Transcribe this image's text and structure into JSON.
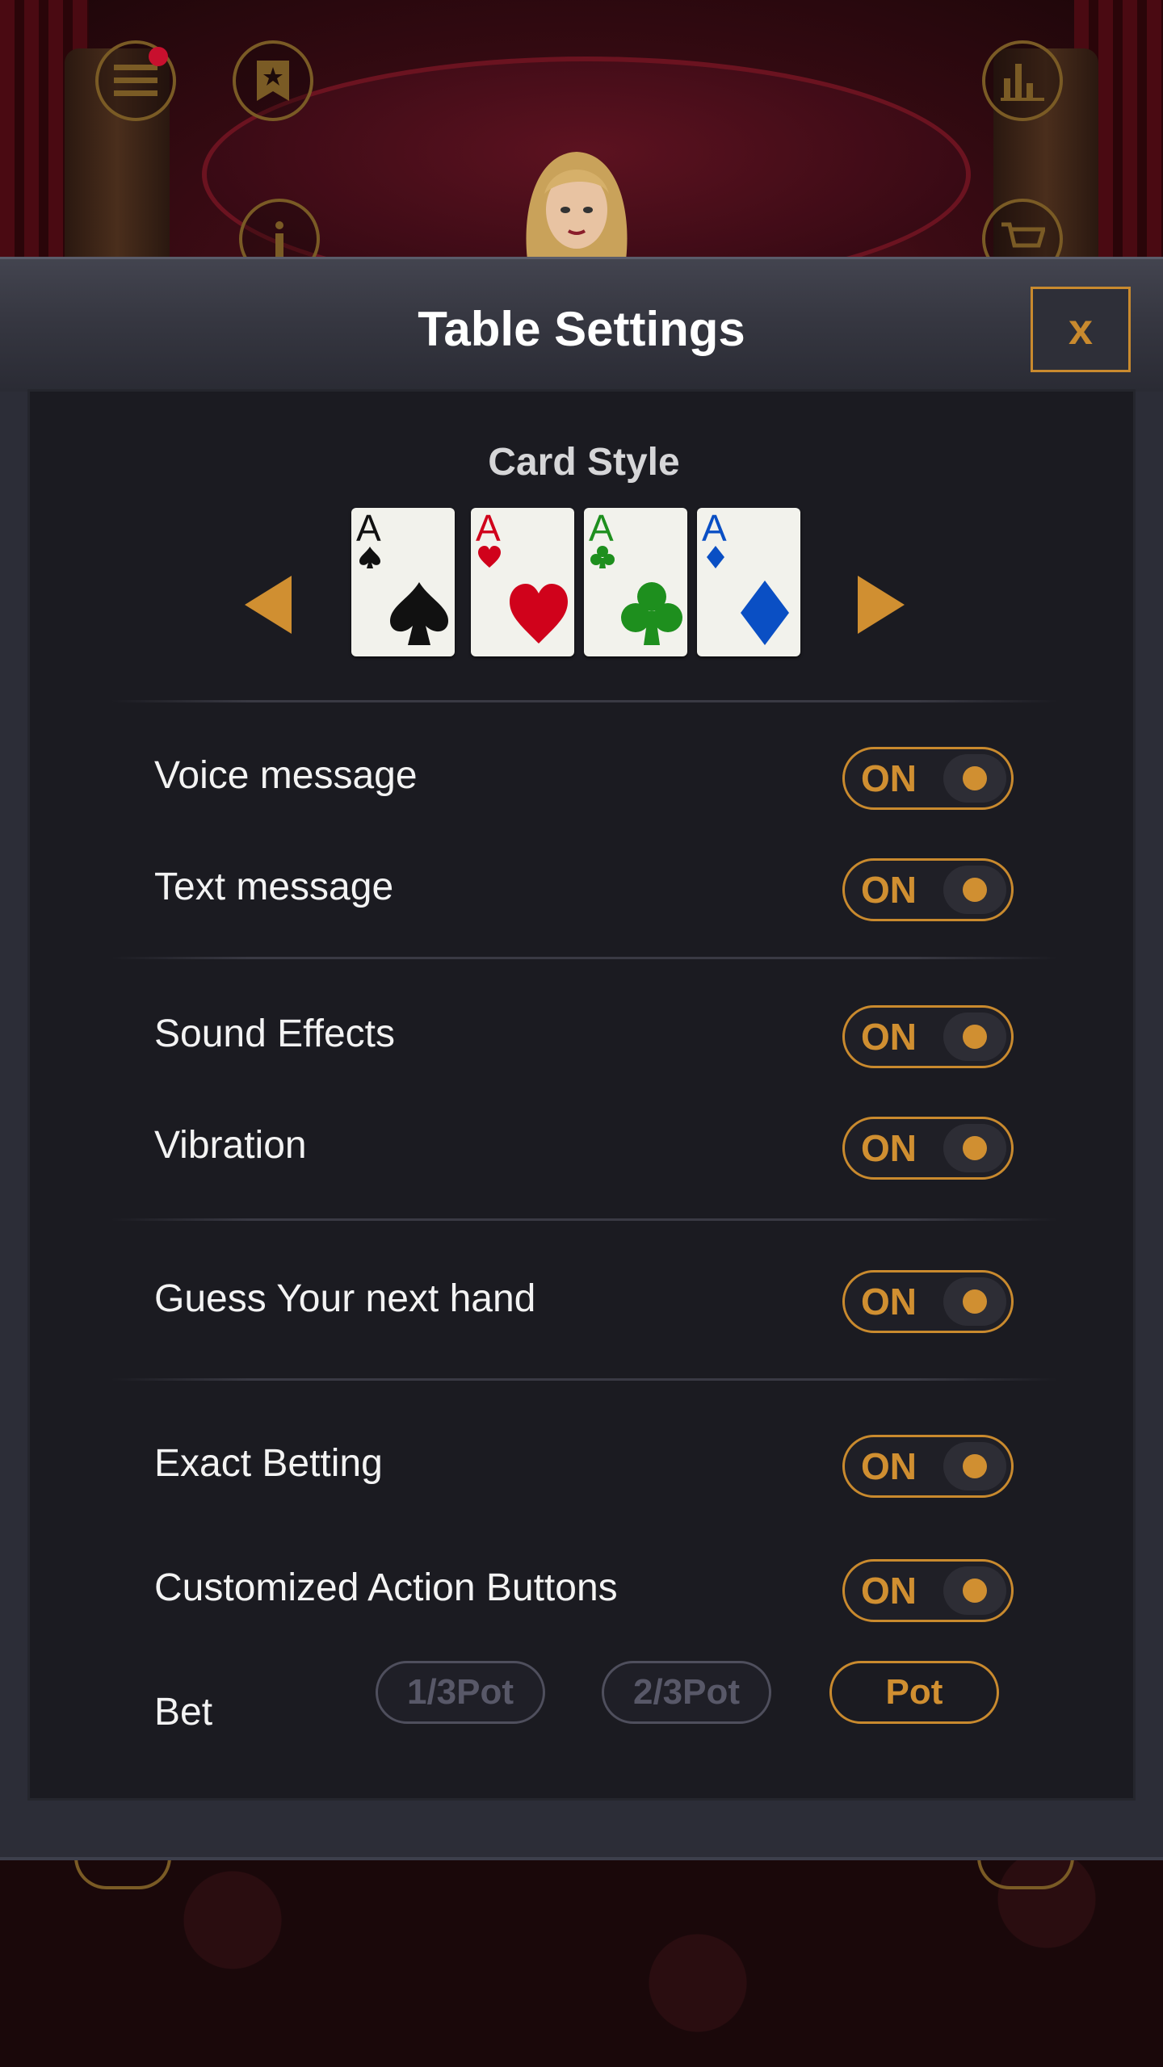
{
  "modal": {
    "title": "Table Settings",
    "close_label": "x"
  },
  "card_style": {
    "title": "Card Style",
    "cards": [
      {
        "rank": "A",
        "suit": "spades",
        "color": "#111111"
      },
      {
        "rank": "A",
        "suit": "hearts",
        "color": "#d0021b"
      },
      {
        "rank": "A",
        "suit": "clubs",
        "color": "#1e8f1e"
      },
      {
        "rank": "A",
        "suit": "diamonds",
        "color": "#0a4fc4"
      }
    ]
  },
  "settings": [
    {
      "label": "Voice message",
      "state": "ON"
    },
    {
      "label": "Text message",
      "state": "ON"
    },
    {
      "label": "Sound Effects",
      "state": "ON"
    },
    {
      "label": "Vibration",
      "state": "ON"
    },
    {
      "label": "Guess Your next hand",
      "state": "ON"
    },
    {
      "label": "Exact Betting",
      "state": "ON"
    },
    {
      "label": "Customized Action Buttons",
      "state": "ON"
    }
  ],
  "bet": {
    "label": "Bet",
    "options": [
      "1/3Pot",
      "2/3Pot",
      "Pot"
    ],
    "selected": "Pot"
  },
  "colors": {
    "accent": "#d08f31",
    "panel": "#1b1b21",
    "modal": "#2c2d37"
  },
  "icons": {
    "menu": "menu-icon",
    "bookmark": "bookmark-star-icon",
    "stats": "bar-chart-icon",
    "info": "info-icon",
    "shop": "shopping-cart-icon"
  }
}
